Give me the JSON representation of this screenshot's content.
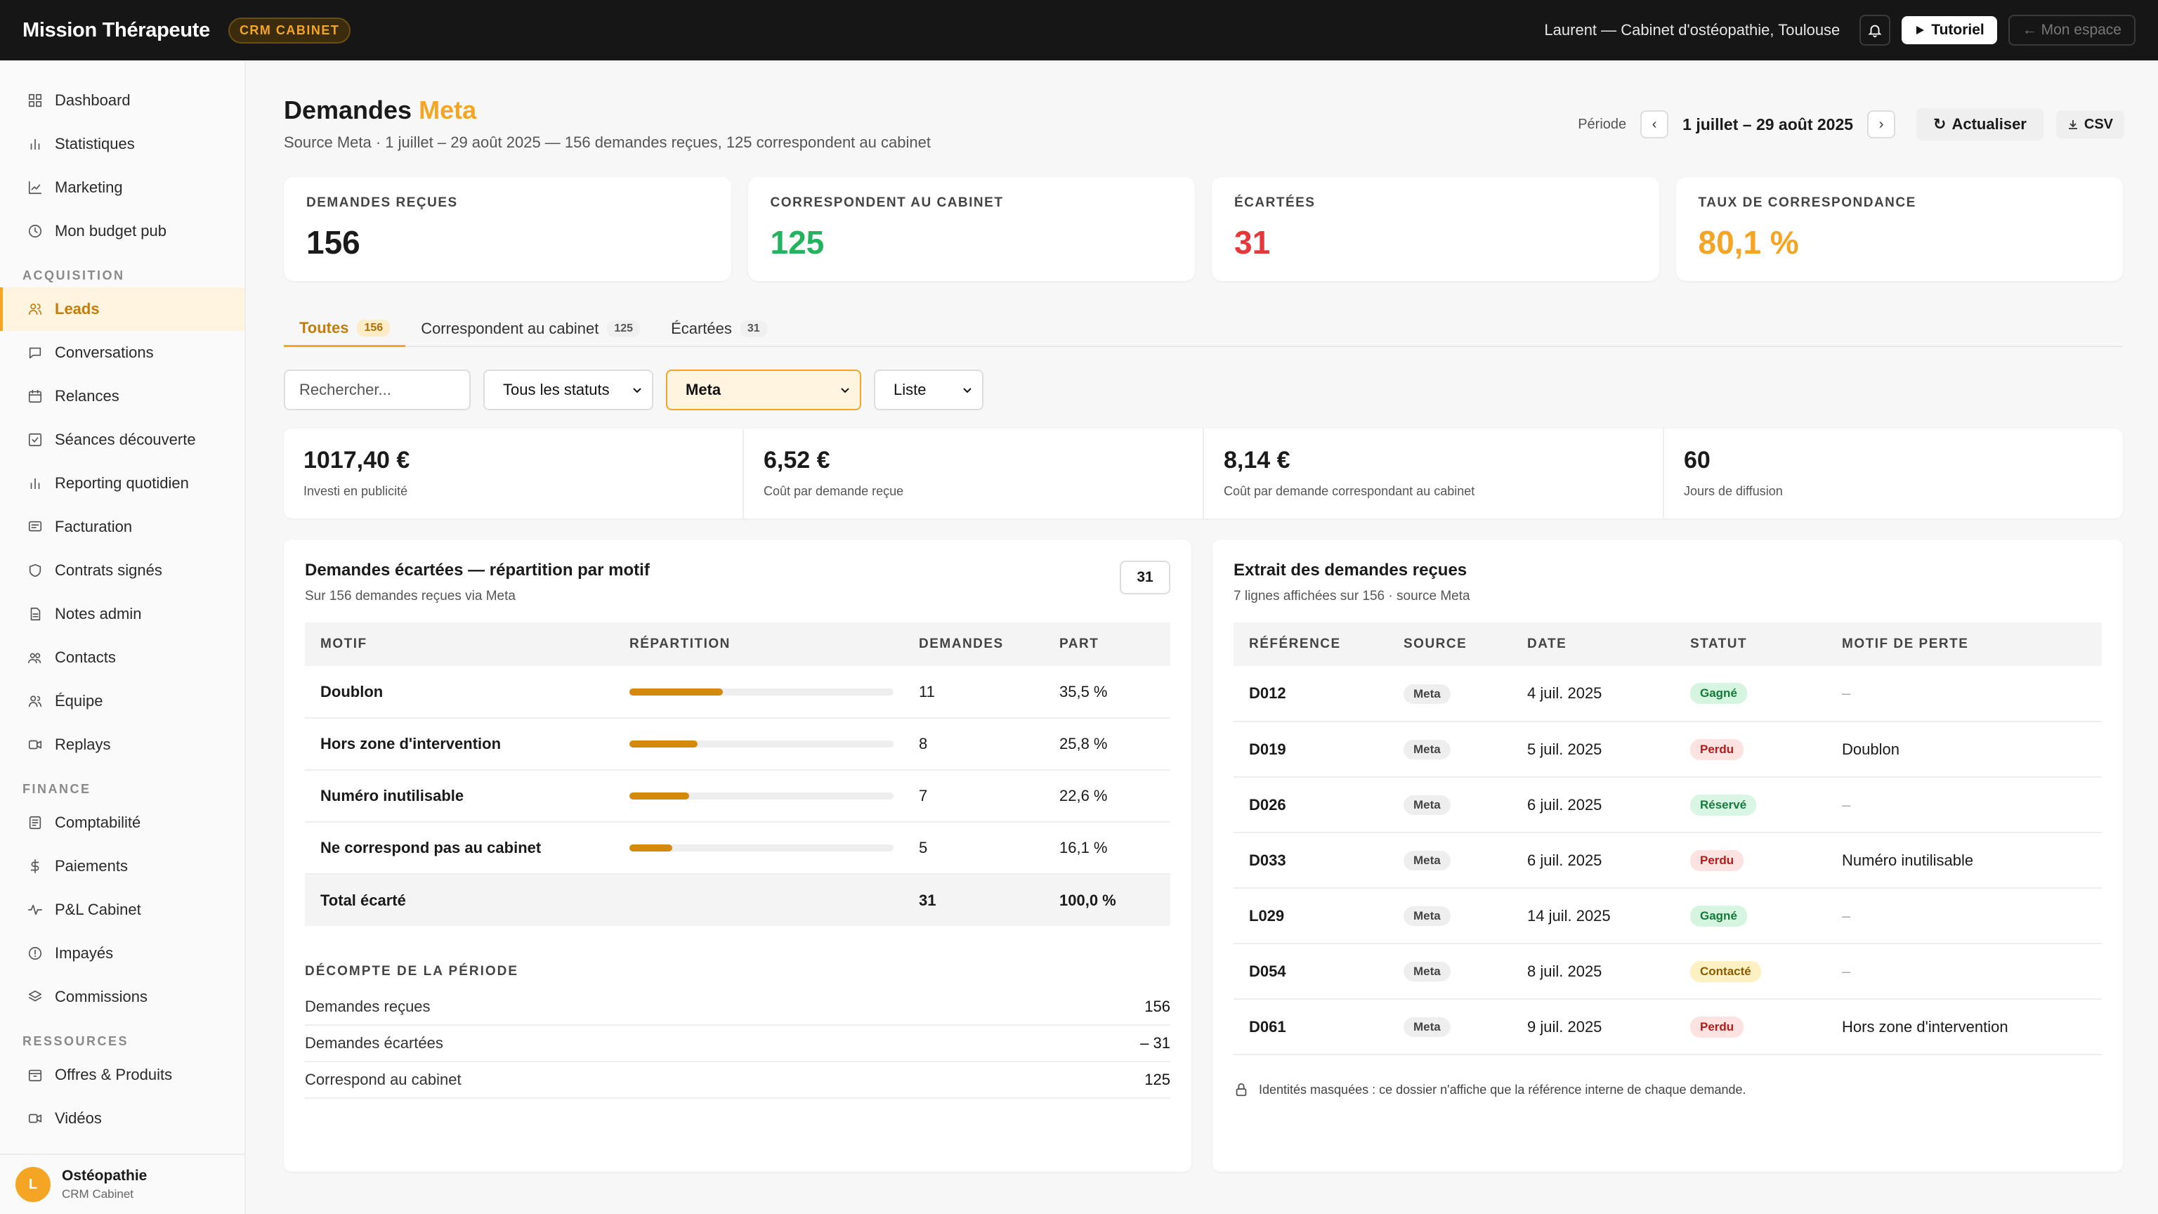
{
  "topbar": {
    "brand": "Mission Thérapeute",
    "badge": "CRM CABINET",
    "user": "Laurent — Cabinet d'ostéopathie, Toulouse",
    "tutorial": "Tutoriel",
    "espace": "← Mon espace"
  },
  "sidebar": {
    "items_main": [
      {
        "label": "Dashboard",
        "icon": "grid-icon"
      },
      {
        "label": "Statistiques",
        "icon": "bar-chart-icon"
      },
      {
        "label": "Marketing",
        "icon": "line-chart-icon"
      },
      {
        "label": "Mon budget pub",
        "icon": "clock-icon"
      }
    ],
    "section_acquisition": "ACQUISITION",
    "items_acquisition": [
      {
        "label": "Leads",
        "icon": "users-icon"
      },
      {
        "label": "Conversations",
        "icon": "chat-icon"
      },
      {
        "label": "Relances",
        "icon": "calendar-icon"
      },
      {
        "label": "Séances découverte",
        "icon": "checkbox-icon"
      },
      {
        "label": "Reporting quotidien",
        "icon": "bar-chart-icon"
      },
      {
        "label": "Facturation",
        "icon": "receipt-icon"
      },
      {
        "label": "Contrats signés",
        "icon": "shield-icon"
      },
      {
        "label": "Notes admin",
        "icon": "document-icon"
      },
      {
        "label": "Contacts",
        "icon": "contacts-icon"
      },
      {
        "label": "Équipe",
        "icon": "team-icon"
      },
      {
        "label": "Replays",
        "icon": "video-icon"
      }
    ],
    "section_finance": "FINANCE",
    "items_finance": [
      {
        "label": "Comptabilité",
        "icon": "ledger-icon"
      },
      {
        "label": "Paiements",
        "icon": "dollar-icon"
      },
      {
        "label": "P&L Cabinet",
        "icon": "pulse-icon"
      },
      {
        "label": "Impayés",
        "icon": "alert-circle-icon"
      },
      {
        "label": "Commissions",
        "icon": "layers-icon"
      }
    ],
    "section_ressources": "RESSOURCES",
    "items_ressources": [
      {
        "label": "Offres & Produits",
        "icon": "package-icon"
      },
      {
        "label": "Vidéos",
        "icon": "video-icon"
      }
    ],
    "footer": {
      "avatar": "L",
      "name": "Ostéopathie",
      "sub": "CRM Cabinet"
    }
  },
  "header": {
    "title": "Demandes",
    "title_accent": "Meta",
    "subtitle": "Source Meta · 1 juillet – 29 août 2025 — 156 demandes reçues, 125 correspondent au cabinet",
    "period_label": "Période",
    "period_value": "1 juillet – 29 août 2025",
    "refresh": "Actualiser",
    "csv": "CSV"
  },
  "kpis": [
    {
      "label": "DEMANDES REÇUES",
      "value": "156",
      "color": "#1a1a1a"
    },
    {
      "label": "CORRESPONDENT AU CABINET",
      "value": "125",
      "color": "#22b35e"
    },
    {
      "label": "ÉCARTÉES",
      "value": "31",
      "color": "#e5383b"
    },
    {
      "label": "TAUX DE CORRESPONDANCE",
      "value": "80,1 %",
      "color": "#f5a524"
    }
  ],
  "tabs": [
    {
      "label": "Toutes",
      "count": "156"
    },
    {
      "label": "Correspondent au cabinet",
      "count": "125"
    },
    {
      "label": "Écartées",
      "count": "31"
    }
  ],
  "filters": {
    "search_placeholder": "Rechercher...",
    "status": "Tous les statuts",
    "source": "Meta",
    "view": "Liste"
  },
  "stats": [
    {
      "value": "1017,40 €",
      "label": "Investi en publicité"
    },
    {
      "value": "6,52 €",
      "label": "Coût par demande reçue"
    },
    {
      "value": "8,14 €",
      "label": "Coût par demande correspondant au cabinet"
    },
    {
      "value": "60",
      "label": "Jours de diffusion"
    }
  ],
  "rejected": {
    "title": "Demandes écartées — répartition par motif",
    "subtitle": "Sur 156 demandes reçues via Meta",
    "count": "31",
    "columns": [
      "MOTIF",
      "RÉPARTITION",
      "DEMANDES",
      "PART"
    ],
    "rows": [
      {
        "motif": "Doublon",
        "share": 0.355,
        "demandes": "11",
        "part": "35,5 %"
      },
      {
        "motif": "Hors zone d'intervention",
        "share": 0.258,
        "demandes": "8",
        "part": "25,8 %"
      },
      {
        "motif": "Numéro inutilisable",
        "share": 0.226,
        "demandes": "7",
        "part": "22,6 %"
      },
      {
        "motif": "Ne correspond pas au cabinet",
        "share": 0.161,
        "demandes": "5",
        "part": "16,1 %"
      }
    ],
    "total": {
      "label": "Total écarté",
      "demandes": "31",
      "part": "100,0 %"
    },
    "decompte_title": "DÉCOMPTE DE LA PÉRIODE",
    "decompte": [
      {
        "label": "Demandes reçues",
        "value": "156"
      },
      {
        "label": "Demandes écartées",
        "value": "– 31"
      },
      {
        "label": "Correspond au cabinet",
        "value": "125"
      }
    ]
  },
  "extract": {
    "title": "Extrait des demandes reçues",
    "subtitle": "7 lignes affichées sur 156 · source Meta",
    "columns": [
      "RÉFÉRENCE",
      "SOURCE",
      "DATE",
      "STATUT",
      "MOTIF DE PERTE"
    ],
    "rows": [
      {
        "ref": "D012",
        "source": "Meta",
        "date": "4 juil. 2025",
        "status": "Gagné",
        "status_class": "st-gagne",
        "motif": "–"
      },
      {
        "ref": "D019",
        "source": "Meta",
        "date": "5 juil. 2025",
        "status": "Perdu",
        "status_class": "st-perdu",
        "motif": "Doublon"
      },
      {
        "ref": "D026",
        "source": "Meta",
        "date": "6 juil. 2025",
        "status": "Réservé",
        "status_class": "st-reserve",
        "motif": "–"
      },
      {
        "ref": "D033",
        "source": "Meta",
        "date": "6 juil. 2025",
        "status": "Perdu",
        "status_class": "st-perdu",
        "motif": "Numéro inutilisable"
      },
      {
        "ref": "L029",
        "source": "Meta",
        "date": "14 juil. 2025",
        "status": "Gagné",
        "status_class": "st-gagne",
        "motif": "–"
      },
      {
        "ref": "D054",
        "source": "Meta",
        "date": "8 juil. 2025",
        "status": "Contacté",
        "status_class": "st-contacte",
        "motif": "–"
      },
      {
        "ref": "D061",
        "source": "Meta",
        "date": "9 juil. 2025",
        "status": "Perdu",
        "status_class": "st-perdu",
        "motif": "Hors zone d'intervention"
      }
    ],
    "note": "Identités masquées : ce dossier n'affiche que la référence interne de chaque demande."
  }
}
